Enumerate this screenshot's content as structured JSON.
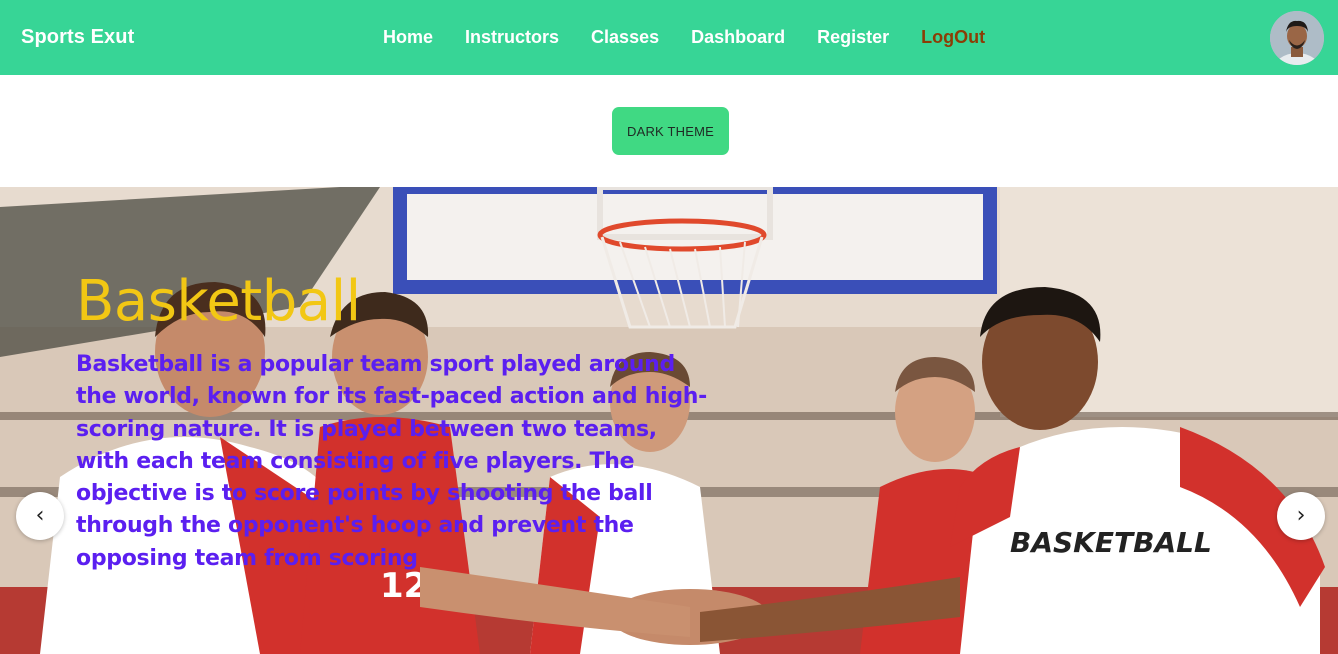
{
  "navbar": {
    "brand": "Sports Exut",
    "links": [
      "Home",
      "Instructors",
      "Classes",
      "Dashboard",
      "Register"
    ],
    "logout_label": "LogOut",
    "background": "#37d596",
    "logout_color": "#8b3d06"
  },
  "theme_button": {
    "label": "DARK THEME",
    "background": "#40d983"
  },
  "hero": {
    "title": "Basketball",
    "description": "Basketball is a popular team sport played around the world, known for its fast-paced action and high-scoring nature. It is played between two teams, with each team consisting of five players. The objective is to score points by shooting the ball through the opponent's hoop and prevent the opposing team from scoring",
    "title_color": "#f2c714",
    "text_color": "#5b1ff0",
    "shirt_print": "BASKETBALL",
    "jersey_number": "12",
    "prev_icon": "‹",
    "next_icon": "›"
  }
}
